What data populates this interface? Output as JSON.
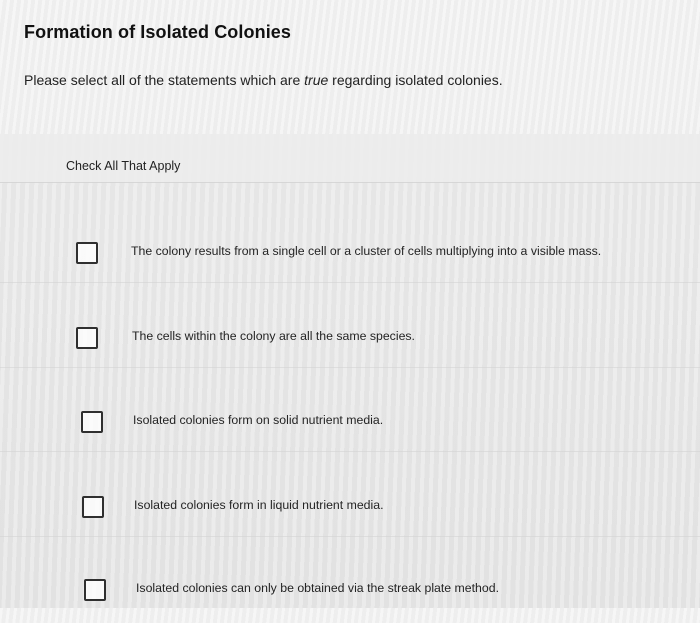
{
  "question": {
    "title": "Formation of Isolated Colonies",
    "prompt_before_emphasis": "Please select all of the statements which are ",
    "prompt_emphasis": "true",
    "prompt_after_emphasis": " regarding isolated colonies."
  },
  "check_all": {
    "label": "Check All That Apply"
  },
  "options": [
    {
      "label": "The colony results from a single cell or a cluster of cells multiplying into a visible mass.",
      "checked": false
    },
    {
      "label": "The cells within the colony are all the same species.",
      "checked": false
    },
    {
      "label": "Isolated colonies form on solid nutrient media.",
      "checked": false
    },
    {
      "label": "Isolated colonies form in liquid nutrient media.",
      "checked": false
    },
    {
      "label": "Isolated colonies can only be obtained via the streak plate method.",
      "checked": false
    }
  ]
}
